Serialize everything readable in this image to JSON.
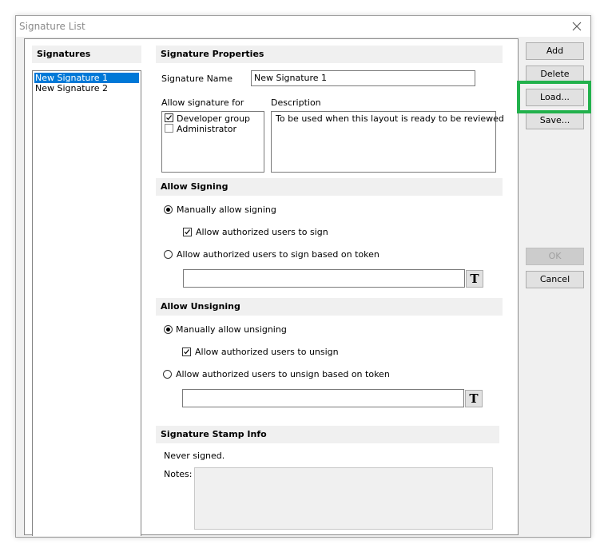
{
  "window": {
    "title": "Signature List"
  },
  "signatures": {
    "header": "Signatures",
    "items": [
      "New Signature 1",
      "New Signature 2"
    ]
  },
  "properties": {
    "header": "Signature Properties",
    "name_label": "Signature Name",
    "name_value": "New Signature 1",
    "allow_label": "Allow signature for",
    "allow_options": [
      {
        "label": "Developer group",
        "checked": true
      },
      {
        "label": "Administrator",
        "checked": false
      }
    ],
    "description_label": "Description",
    "description_value": "To be used when this layout is ready to be reviewed"
  },
  "allow_signing": {
    "header": "Allow Signing",
    "manual_label": "Manually allow signing",
    "manual_selected": true,
    "authorized_label": "Allow authorized users to sign",
    "authorized_checked": true,
    "token_label": "Allow authorized users to sign based on token",
    "token_selected": false,
    "token_value": "",
    "token_button": "T"
  },
  "allow_unsigning": {
    "header": "Allow Unsigning",
    "manual_label": "Manually allow unsigning",
    "manual_selected": true,
    "authorized_label": "Allow authorized users to unsign",
    "authorized_checked": true,
    "token_label": "Allow authorized users to unsign based on token",
    "token_selected": false,
    "token_value": "",
    "token_button": "T"
  },
  "stamp": {
    "header": "Signature Stamp Info",
    "status": "Never signed.",
    "notes_label": "Notes:",
    "notes_value": ""
  },
  "buttons": {
    "add": "Add",
    "delete": "Delete",
    "load": "Load...",
    "save": "Save...",
    "ok": "OK",
    "cancel": "Cancel"
  },
  "colors": {
    "selection": "#0078d7",
    "highlight": "#22b14c"
  }
}
